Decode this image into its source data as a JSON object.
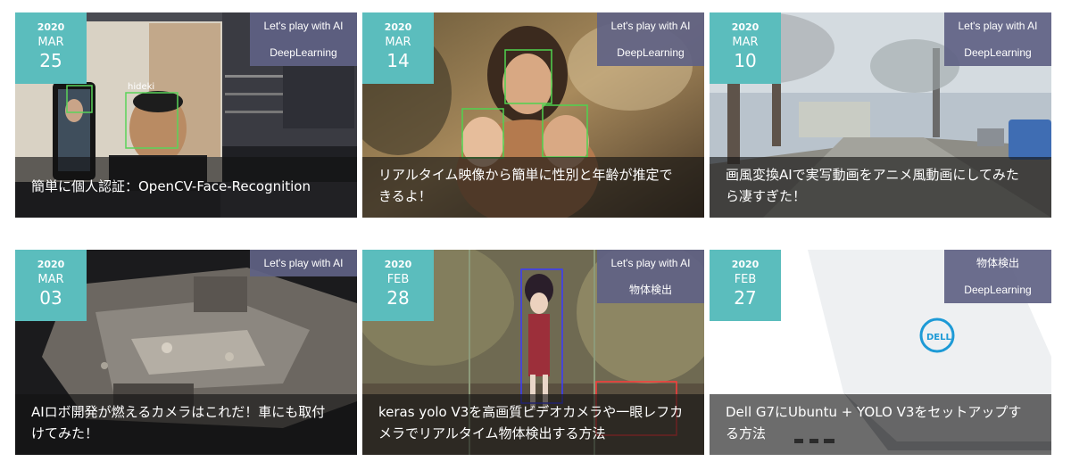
{
  "colors": {
    "date_badge": "#5bbdbd",
    "category_badge": "#606284",
    "caption_overlay": "#121212"
  },
  "posts": [
    {
      "year": "2020",
      "month": "MAR",
      "day": "25",
      "categories": [
        "Let's play with AI",
        "DeepLearning"
      ],
      "title": "簡単に個人認証：OpenCV-Face-Recognition",
      "image": "face-recognition-screenshot",
      "overlay_labels": [
        "hideki"
      ]
    },
    {
      "year": "2020",
      "month": "MAR",
      "day": "14",
      "categories": [
        "Let's play with AI",
        "DeepLearning"
      ],
      "title": "リアルタイム映像から簡単に性別と年齢が推定できるよ！",
      "image": "mother-and-children-photo"
    },
    {
      "year": "2020",
      "month": "MAR",
      "day": "10",
      "categories": [
        "Let's play with AI",
        "DeepLearning"
      ],
      "title": "画風変換AIで実写動画をアニメ風動画にしてみたら凄すぎた！",
      "image": "anime-style-street"
    },
    {
      "year": "2020",
      "month": "MAR",
      "day": "03",
      "categories": [
        "Let's play with AI"
      ],
      "title": "AIロボ開発が燃えるカメラはこれだ！車にも取付けてみた！",
      "image": "3d-point-cloud-room"
    },
    {
      "year": "2020",
      "month": "FEB",
      "day": "28",
      "categories": [
        "Let's play with AI",
        "物体検出"
      ],
      "title": "keras yolo V3を高画質ビデオカメラや一眼レフカメラでリアルタイム物体検出する方法",
      "image": "figure-detection-photo"
    },
    {
      "year": "2020",
      "month": "FEB",
      "day": "27",
      "categories": [
        "物体検出",
        "DeepLearning"
      ],
      "title": "Dell G7にUbuntu + YOLO V3をセットアップする方法",
      "image": "dell-laptop-photo"
    }
  ]
}
